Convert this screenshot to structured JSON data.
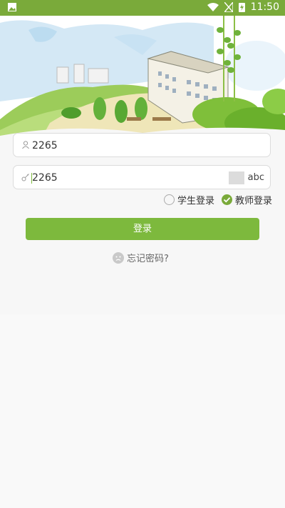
{
  "status_bar": {
    "time": "11:50"
  },
  "login": {
    "username_value": "2265",
    "password_value": "2265",
    "captcha_text": "abc"
  },
  "roles": {
    "student_label": "学生登录",
    "teacher_label": "教师登录",
    "selected": "teacher"
  },
  "buttons": {
    "login_label": "登录",
    "forgot_label": "忘记密码?"
  },
  "colors": {
    "accent": "#7db93d",
    "status_bar": "#7aaa3a"
  }
}
